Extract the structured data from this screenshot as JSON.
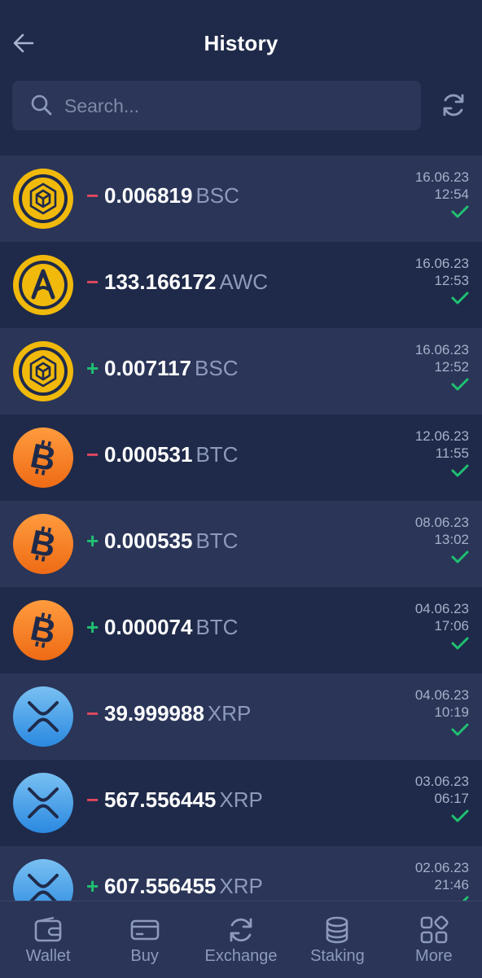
{
  "header": {
    "title": "History"
  },
  "search": {
    "placeholder": "Search...",
    "value": ""
  },
  "transactions": [
    {
      "coin": "bsc",
      "sign": "−",
      "direction": "out",
      "amount": "0.006819",
      "ticker": "BSC",
      "date": "16.06.23",
      "time": "12:54",
      "status": "confirmed"
    },
    {
      "coin": "awc",
      "sign": "−",
      "direction": "out",
      "amount": "133.166172",
      "ticker": "AWC",
      "date": "16.06.23",
      "time": "12:53",
      "status": "confirmed"
    },
    {
      "coin": "bsc",
      "sign": "+",
      "direction": "in",
      "amount": "0.007117",
      "ticker": "BSC",
      "date": "16.06.23",
      "time": "12:52",
      "status": "confirmed"
    },
    {
      "coin": "btc",
      "sign": "−",
      "direction": "out",
      "amount": "0.000531",
      "ticker": "BTC",
      "date": "12.06.23",
      "time": "11:55",
      "status": "confirmed"
    },
    {
      "coin": "btc",
      "sign": "+",
      "direction": "in",
      "amount": "0.000535",
      "ticker": "BTC",
      "date": "08.06.23",
      "time": "13:02",
      "status": "confirmed"
    },
    {
      "coin": "btc",
      "sign": "+",
      "direction": "in",
      "amount": "0.000074",
      "ticker": "BTC",
      "date": "04.06.23",
      "time": "17:06",
      "status": "confirmed"
    },
    {
      "coin": "xrp",
      "sign": "−",
      "direction": "out",
      "amount": "39.999988",
      "ticker": "XRP",
      "date": "04.06.23",
      "time": "10:19",
      "status": "confirmed"
    },
    {
      "coin": "xrp",
      "sign": "−",
      "direction": "out",
      "amount": "567.556445",
      "ticker": "XRP",
      "date": "03.06.23",
      "time": "06:17",
      "status": "confirmed"
    },
    {
      "coin": "xrp",
      "sign": "+",
      "direction": "in",
      "amount": "607.556455",
      "ticker": "XRP",
      "date": "02.06.23",
      "time": "21:46",
      "status": "confirmed"
    }
  ],
  "tabs": [
    {
      "label": "Wallet",
      "icon": "wallet-icon"
    },
    {
      "label": "Buy",
      "icon": "card-icon"
    },
    {
      "label": "Exchange",
      "icon": "exchange-icon"
    },
    {
      "label": "Staking",
      "icon": "coins-stack-icon"
    },
    {
      "label": "More",
      "icon": "grid-icon"
    }
  ],
  "colors": {
    "background": "#1f2a4a",
    "row_alt": "#2a3558",
    "negative": "#e5485f",
    "positive": "#20c070",
    "muted": "#8e9abb"
  }
}
